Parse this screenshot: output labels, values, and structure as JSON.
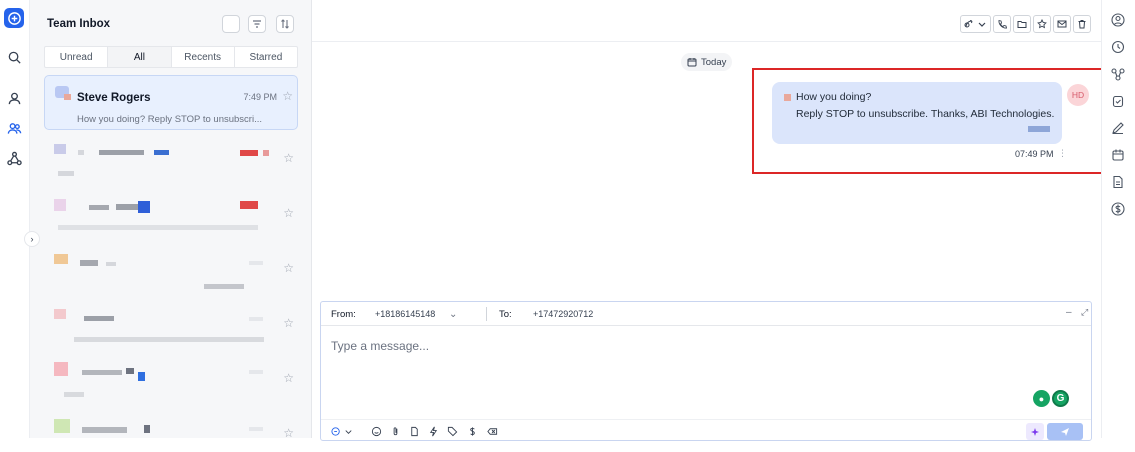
{
  "inbox": {
    "title": "Team Inbox",
    "tabs": [
      "Unread",
      "All",
      "Recents",
      "Starred"
    ],
    "active_tab": "All"
  },
  "conversations": [
    {
      "name": "Steve Rogers",
      "time": "7:49 PM",
      "preview": "How you doing? Reply STOP to unsubscri...",
      "selected": true
    }
  ],
  "chat": {
    "date_label": "Today",
    "message": {
      "line1": "How you doing?",
      "line2": "Reply STOP to unsubscribe. Thanks, ABI Technologies.",
      "time": "07:49 PM",
      "sender_initials": "HD"
    }
  },
  "composer": {
    "from_label": "From:",
    "from_number": "+18186145148",
    "to_label": "To:",
    "to_number": "+17472920712",
    "placeholder": "Type a message...",
    "grammarly_label": "G"
  },
  "icons": {
    "left_rail": [
      "new-chat-icon",
      "search-icon",
      "contact-icon",
      "team-inbox-icon",
      "workflow-icon"
    ],
    "right_rail": [
      "user-circle-icon",
      "history-icon",
      "integration-icon",
      "task-icon",
      "pen-icon",
      "calendar-icon",
      "notes-icon",
      "dollar-icon"
    ]
  },
  "colors": {
    "accent": "#2563eb",
    "highlight_border": "#dc2626",
    "bubble": "#dbe5fb",
    "selected_row": "#e8f0fe"
  }
}
